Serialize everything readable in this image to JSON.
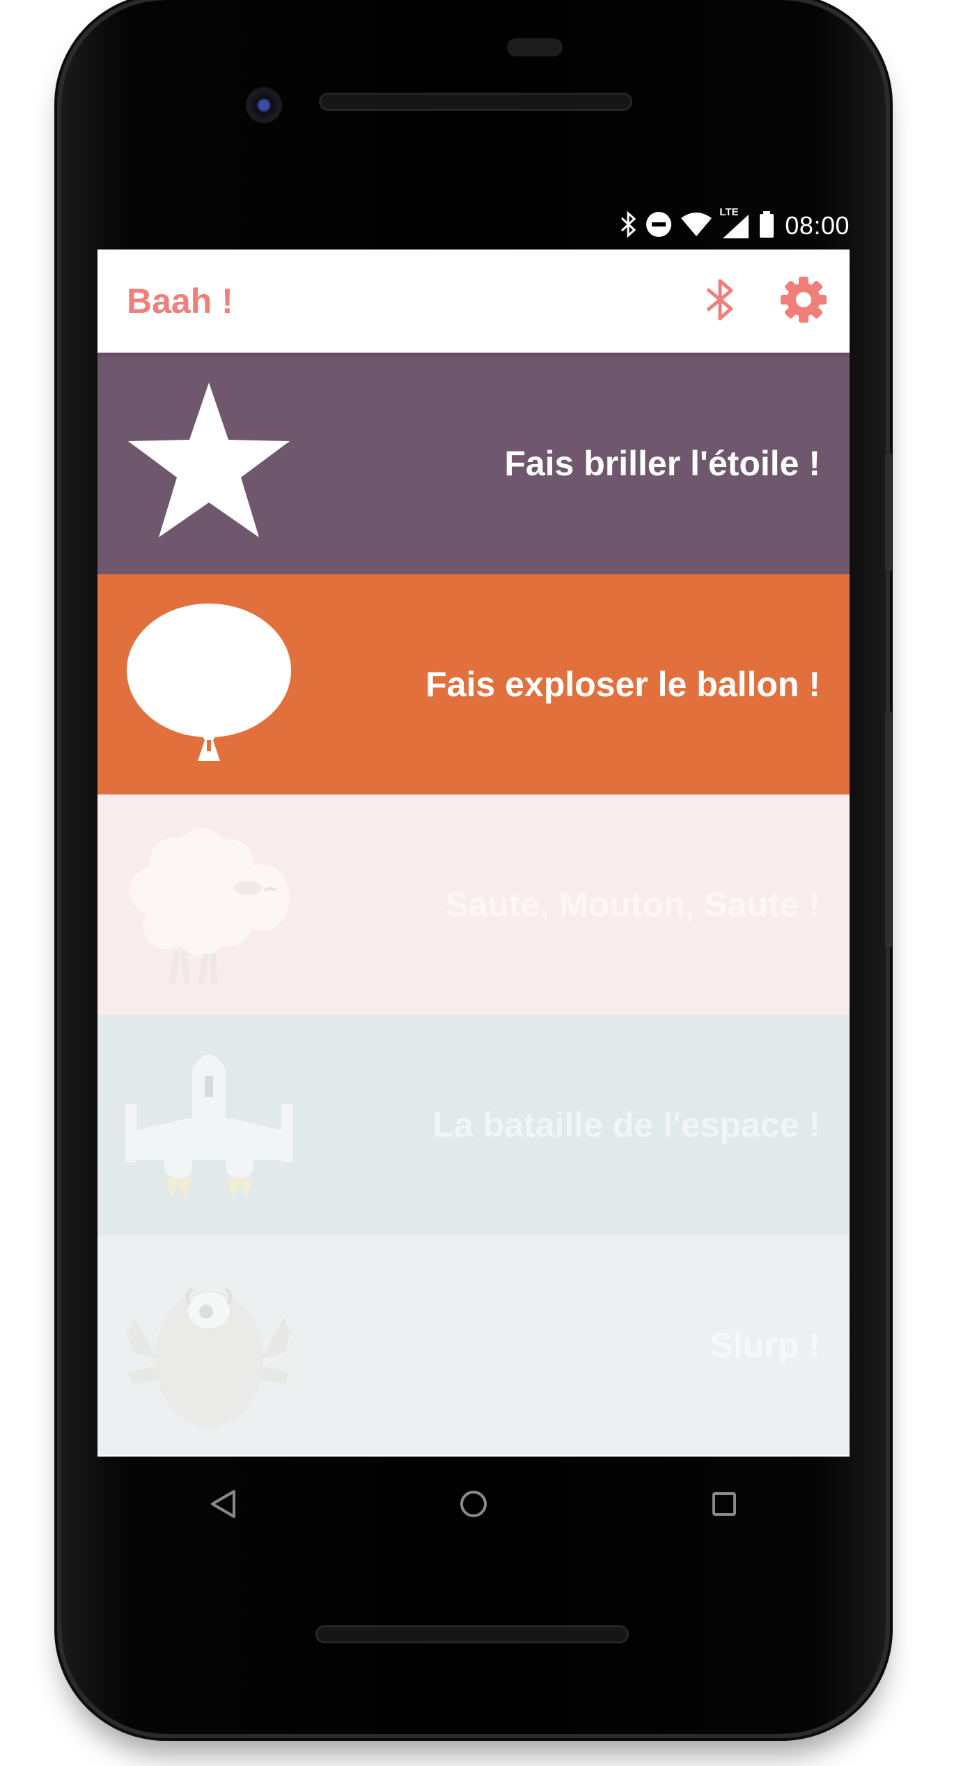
{
  "status_bar": {
    "time": "08:00",
    "network": "LTE"
  },
  "app_bar": {
    "title": "Baah !",
    "accent_color": "#ef7f78",
    "actions": [
      {
        "icon": "bluetooth-icon"
      },
      {
        "icon": "gear-icon"
      }
    ]
  },
  "games": [
    {
      "title": "Fais briller l'étoile !",
      "color": "#6f576d",
      "icon": "star-icon",
      "enabled": true
    },
    {
      "title": "Fais exploser le ballon !",
      "color": "#e2703c",
      "icon": "balloon-icon",
      "enabled": true
    },
    {
      "title": "Saute, Mouton, Saute !",
      "color": "#f9ecec",
      "icon": "sheep-icon",
      "enabled": false
    },
    {
      "title": "La bataille de l'espace !",
      "color": "#e2e9eb",
      "icon": "spaceship-icon",
      "enabled": false
    },
    {
      "title": "Slurp !",
      "color": "#edf0f1",
      "icon": "frog-icon",
      "enabled": false
    }
  ],
  "nav_bar": {
    "buttons": [
      "back-icon",
      "home-icon",
      "recents-icon"
    ]
  }
}
